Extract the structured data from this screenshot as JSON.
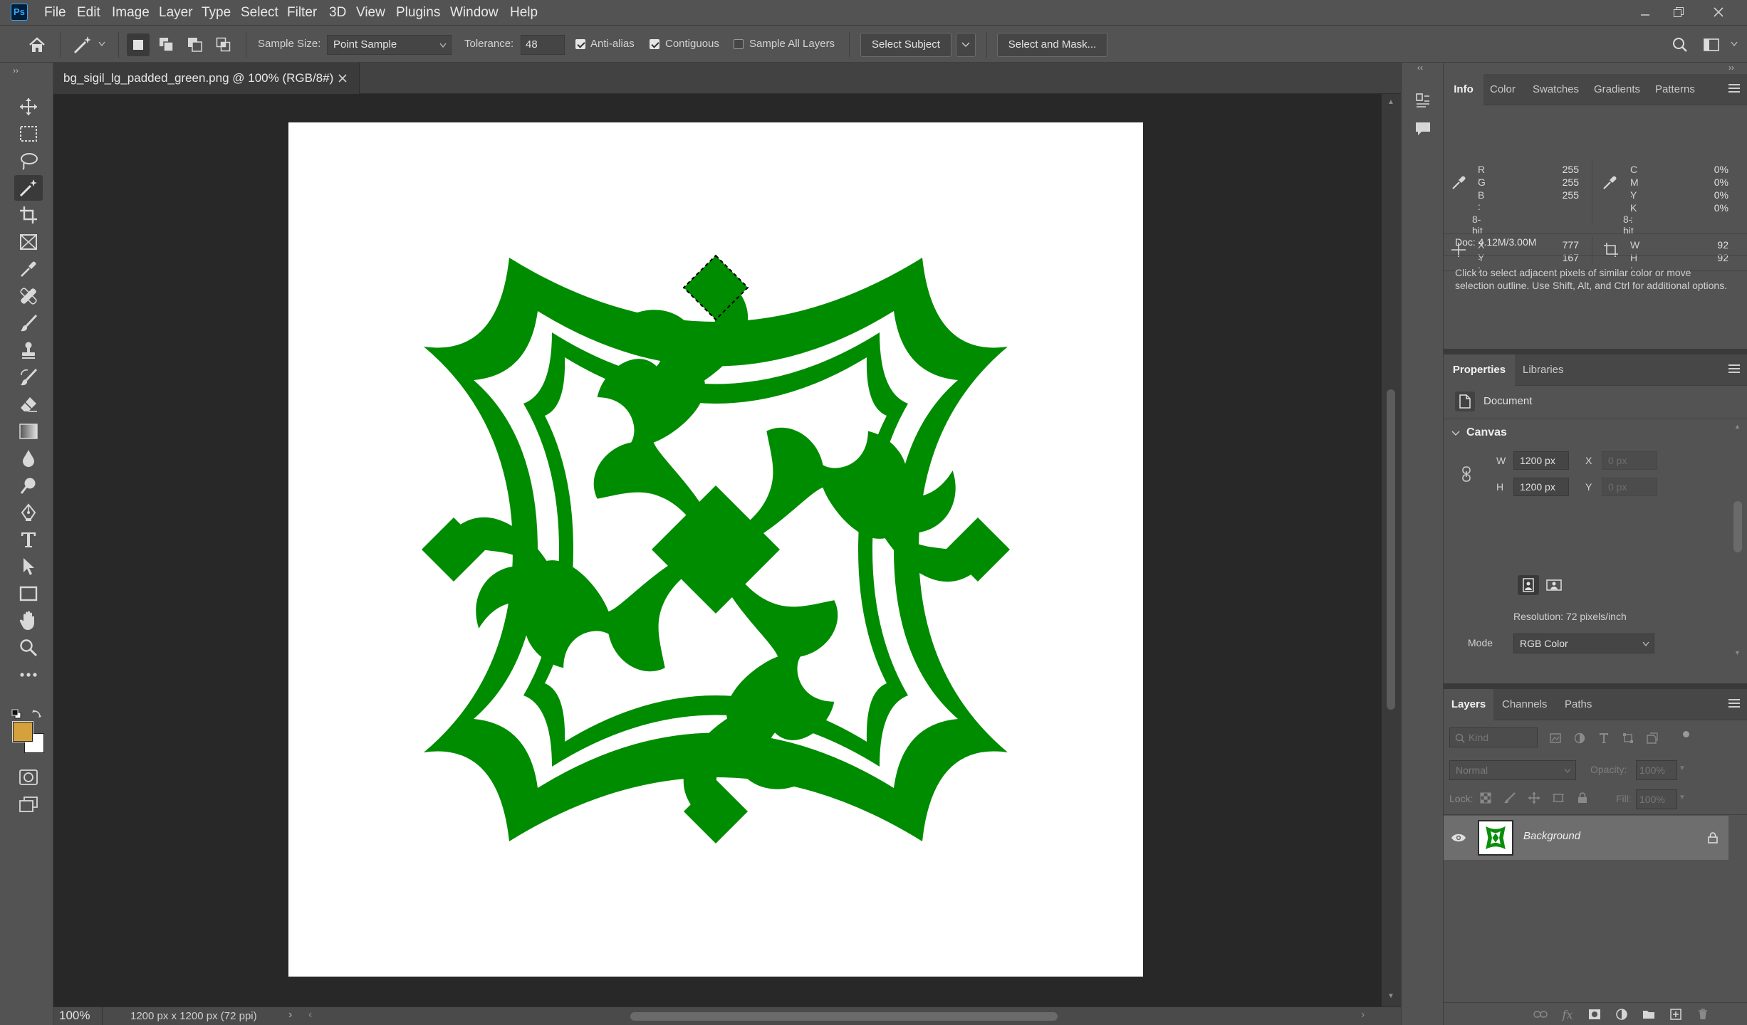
{
  "app": {
    "logo": "Ps"
  },
  "menu": [
    "File",
    "Edit",
    "Image",
    "Layer",
    "Type",
    "Select",
    "Filter",
    "3D",
    "View",
    "Plugins",
    "Window",
    "Help"
  ],
  "options": {
    "sample_size_label": "Sample Size:",
    "sample_size_value": "Point Sample",
    "tolerance_label": "Tolerance:",
    "tolerance_value": "48",
    "anti_alias": "Anti-alias",
    "anti_alias_checked": true,
    "contiguous": "Contiguous",
    "contiguous_checked": true,
    "sample_all_layers": "Sample All Layers",
    "sample_all_layers_checked": false,
    "select_subject": "Select Subject",
    "select_and_mask": "Select and Mask..."
  },
  "document": {
    "tab_title": "bg_sigil_lg_padded_green.png @ 100% (RGB/8#)",
    "artwork_color": "#008c00",
    "zoom": "100%",
    "status": "1200 px x 1200 px (72 ppi)"
  },
  "colors": {
    "foreground": "#d4a13d",
    "background": "#ffffff"
  },
  "info_panel": {
    "tabs": [
      "Info",
      "Color",
      "Swatches",
      "Gradients",
      "Patterns"
    ],
    "rgb": [
      {
        "k": "R :",
        "v": "255"
      },
      {
        "k": "G :",
        "v": "255"
      },
      {
        "k": "B :",
        "v": "255"
      }
    ],
    "cmyk": [
      {
        "k": "C :",
        "v": "0%"
      },
      {
        "k": "M :",
        "v": "0%"
      },
      {
        "k": "Y :",
        "v": "0%"
      },
      {
        "k": "K :",
        "v": "0%"
      }
    ],
    "bit_left": "8-bit",
    "bit_right": "8-bit",
    "xy": [
      {
        "k": "X :",
        "v": "777"
      },
      {
        "k": "Y :",
        "v": "167"
      }
    ],
    "wh": [
      {
        "k": "W :",
        "v": "92"
      },
      {
        "k": "H :",
        "v": "92"
      }
    ],
    "doc": "Doc: 4.12M/3.00M",
    "hint": "Click to select adjacent pixels of similar color or move selection outline.  Use Shift, Alt, and Ctrl for additional options."
  },
  "properties_panel": {
    "tabs": [
      "Properties",
      "Libraries"
    ],
    "doc_label": "Document",
    "canvas_header": "Canvas",
    "w_label": "W",
    "w_value": "1200 px",
    "h_label": "H",
    "h_value": "1200 px",
    "x_label": "X",
    "x_placeholder": "0 px",
    "y_label": "Y",
    "y_placeholder": "0 px",
    "resolution": "Resolution: 72 pixels/inch",
    "mode_label": "Mode",
    "mode_value": "RGB Color"
  },
  "layers_panel": {
    "tabs": [
      "Layers",
      "Channels",
      "Paths"
    ],
    "kind_placeholder": "Kind",
    "blend_mode": "Normal",
    "opacity_label": "Opacity:",
    "opacity_value": "100%",
    "lock_label": "Lock:",
    "fill_label": "Fill:",
    "fill_value": "100%",
    "layers": [
      {
        "name": "Background",
        "visible": true,
        "locked": true
      }
    ]
  }
}
